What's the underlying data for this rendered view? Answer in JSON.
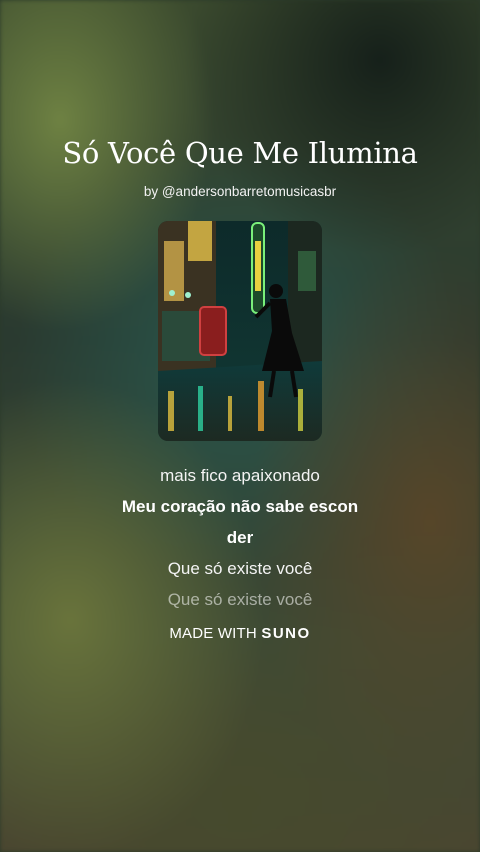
{
  "song": {
    "title": "Só Você Que Me Ilumina",
    "byline": "by @andersonbarretomusicasbr"
  },
  "lyrics": [
    "mais fico apaixonado",
    "Meu coração não sabe escon",
    "der",
    "Que só existe você",
    "Que só existe você"
  ],
  "footer": {
    "made_with": "MADE WITH",
    "brand": "SUNO"
  },
  "cover": {
    "icon": "album-cover-image"
  }
}
